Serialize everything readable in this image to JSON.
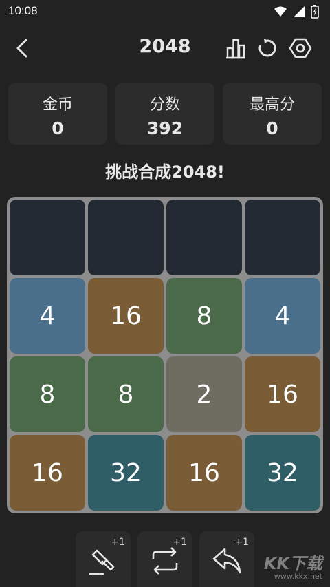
{
  "status": {
    "time": "10:08",
    "icons": [
      "wifi-icon",
      "signal-icon",
      "battery-charging-icon"
    ]
  },
  "header": {
    "title": "2048",
    "icons": [
      "back-icon",
      "leaderboard-icon",
      "restart-icon",
      "settings-hex-icon"
    ]
  },
  "stats": [
    {
      "label": "金币",
      "value": "0"
    },
    {
      "label": "分数",
      "value": "392"
    },
    {
      "label": "最高分",
      "value": "0"
    }
  ],
  "challenge_text": "挑战合成2048!",
  "board": {
    "rows": [
      [
        "",
        "",
        "",
        ""
      ],
      [
        "4",
        "16",
        "8",
        "4"
      ],
      [
        "8",
        "8",
        "2",
        "16"
      ],
      [
        "16",
        "32",
        "16",
        "32"
      ]
    ]
  },
  "tile_colors": {
    "empty": "#242a33",
    "2": "#6f6c62",
    "4": "#4a6f8b",
    "8": "#4a6a4a",
    "16": "#7a5c36",
    "32": "#2f5e66",
    "board": "#8d8d8d"
  },
  "tools": [
    {
      "name": "hammer-icon",
      "badge": "+1"
    },
    {
      "name": "swap-icon",
      "badge": "+1"
    },
    {
      "name": "undo-icon",
      "badge": "+1"
    }
  ],
  "watermark": {
    "text": "KK下载",
    "url": "www.kkx.net"
  }
}
